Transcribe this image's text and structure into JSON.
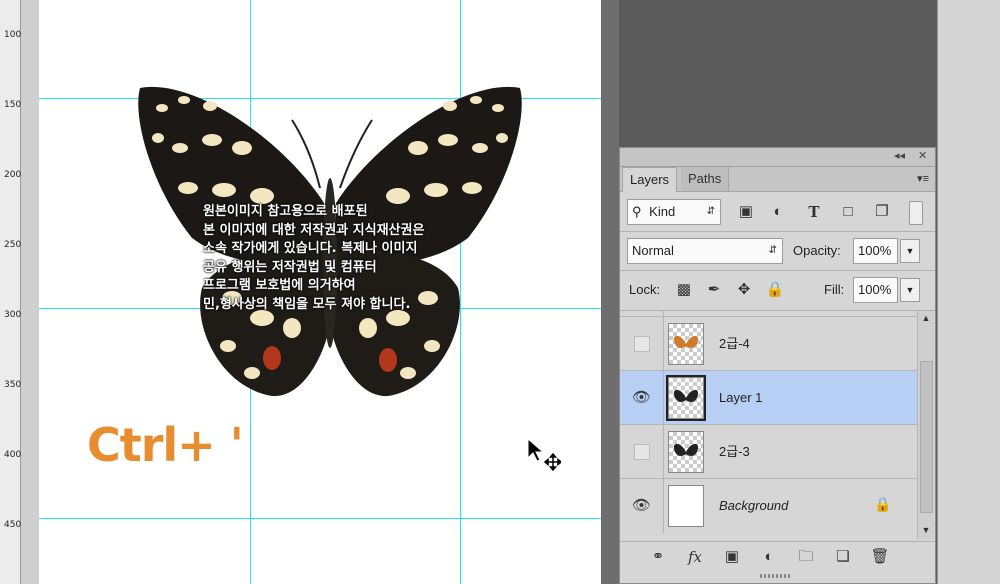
{
  "ruler": {
    "labels": [
      "100",
      "150",
      "200",
      "250",
      "300",
      "350",
      "400",
      "450"
    ]
  },
  "canvas": {
    "overlay_text": [
      "원본이미지 참고용으로 배포된",
      "본 이미지에 대한 저작권과 지식재산권은",
      "소속 작가에게 있습니다. 복제나 이미지",
      "공유 행위는 저작권법 및 컴퓨터",
      "프로그램 보호법에 의거하여",
      "민,형사상의 책임을 모두 져야 합니다."
    ],
    "shortcut": "Ctrl+ '"
  },
  "panel": {
    "top_controls": {
      "collapse": "◂◂",
      "close": "✕"
    },
    "tabs": [
      {
        "label": "Layers",
        "active": true
      },
      {
        "label": "Paths",
        "active": false
      }
    ],
    "menu": "▾≡",
    "filter": {
      "kind_icon": "search-icon",
      "kind_value": "Kind"
    },
    "blend_mode": "Normal",
    "opacity_label": "Opacity:",
    "opacity_value": "100%",
    "lock_label": "Lock:",
    "fill_label": "Fill:",
    "fill_value": "100%",
    "layers": [
      {
        "name": "2급-4",
        "visible": false,
        "selected": false,
        "italic": false,
        "thumb": "butterfly-orange"
      },
      {
        "name": "Layer 1",
        "visible": true,
        "selected": true,
        "italic": false,
        "thumb": "butterfly-black"
      },
      {
        "name": "2급-3",
        "visible": false,
        "selected": false,
        "italic": false,
        "thumb": "butterfly-black"
      },
      {
        "name": "Background",
        "visible": true,
        "selected": false,
        "italic": true,
        "thumb": "white",
        "locked": true
      }
    ],
    "colors": {
      "selected_row": "#b8cff5",
      "guide": "#29e3e8",
      "shortcut_text": "#e88d2f"
    }
  }
}
